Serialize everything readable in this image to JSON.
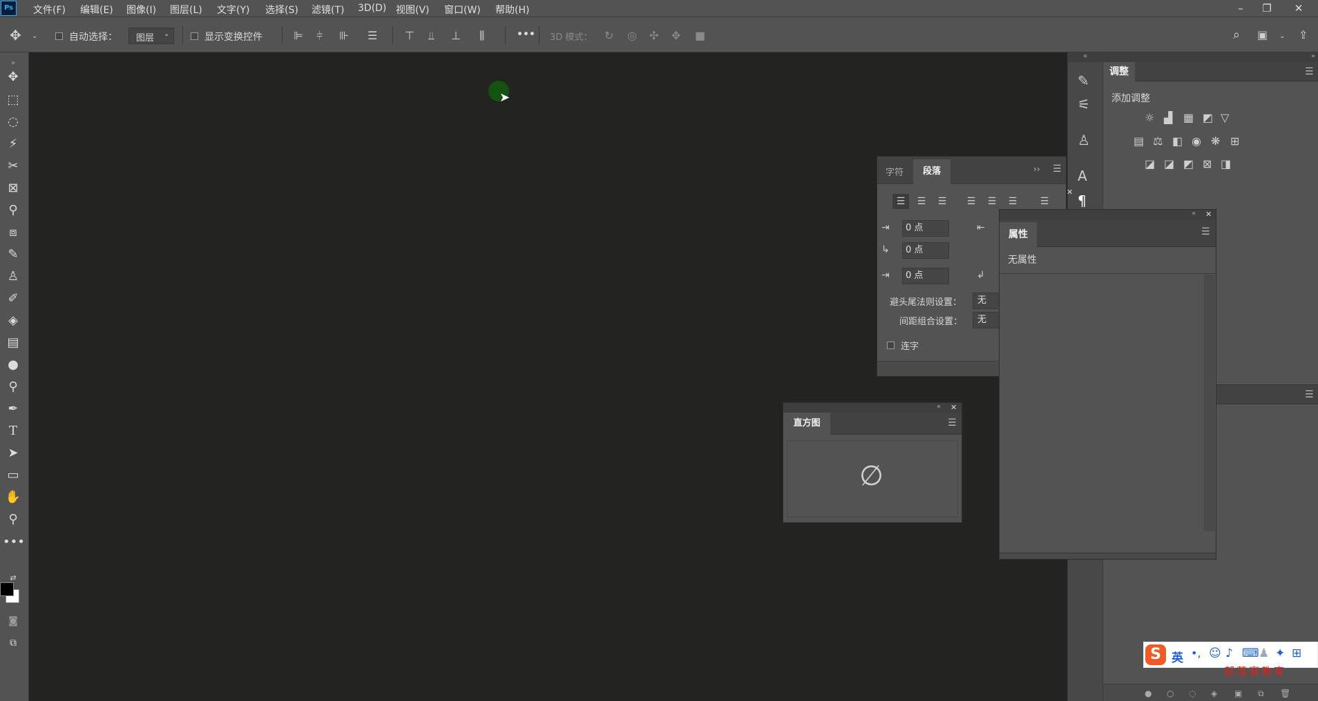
{
  "app": {
    "logo": "Ps"
  },
  "menu": [
    "文件(F)",
    "编辑(E)",
    "图像(I)",
    "图层(L)",
    "文字(Y)",
    "选择(S)",
    "滤镜(T)",
    "3D(D)",
    "视图(V)",
    "窗口(W)",
    "帮助(H)"
  ],
  "window_controls": {
    "minimize": "–",
    "restore": "❐",
    "close": "✕"
  },
  "options": {
    "auto_select_label": "自动选择：",
    "auto_select_value": "图层",
    "show_transform_label": "显示变换控件",
    "more": "•••",
    "mode_3d_label": "3D 模式："
  },
  "paragraph_panel": {
    "tabs": [
      "字符",
      "段落"
    ],
    "active_tab": "段落",
    "indent_left": "0 点",
    "indent_first": "0 点",
    "space_before": "0 点",
    "kinsoku_label": "避头尾法则设置：",
    "kinsoku_value": "无",
    "mojikumi_label": "间距组合设置：",
    "mojikumi_value": "无",
    "hyphenate_label": "连字"
  },
  "properties_panel": {
    "title": "属性",
    "empty_text": "无属性"
  },
  "adjustments_panel": {
    "title": "调整",
    "subtitle": "添加调整"
  },
  "histogram_panel": {
    "title": "直方图",
    "empty_glyph": "∅"
  },
  "ime": {
    "lang": "英",
    "watermark": "部落窝教育"
  },
  "colors": {
    "canvas_bg": "#232422",
    "ui_bg": "#535353",
    "foreground": "#000000",
    "background": "#ffffff",
    "cursor_dot": "#13520f"
  }
}
